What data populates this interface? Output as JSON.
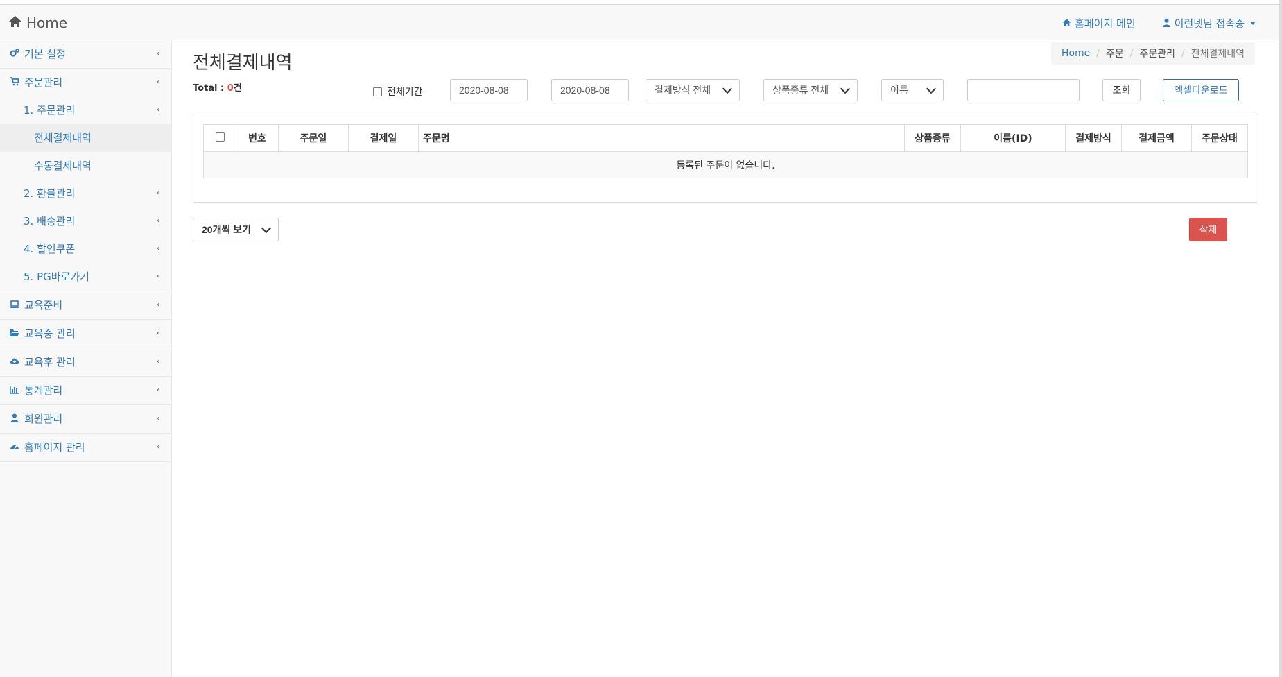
{
  "navbar": {
    "brand": "Home",
    "homepage_main": "홈페이지 메인",
    "user_status": "이런넷님 접속중"
  },
  "sidebar": {
    "items": [
      {
        "label": "기본 설정",
        "icon": "gears-icon"
      },
      {
        "label": "주문관리",
        "icon": "cart-icon"
      },
      {
        "label": "1. 주문관리"
      },
      {
        "label": "전체결제내역"
      },
      {
        "label": "수동결제내역"
      },
      {
        "label": "2. 환불관리"
      },
      {
        "label": "3. 배송관리"
      },
      {
        "label": "4. 할인쿠폰"
      },
      {
        "label": "5. PG바로가기"
      },
      {
        "label": "교육준비",
        "icon": "laptop-icon"
      },
      {
        "label": "교육중 관리",
        "icon": "folder-open-icon"
      },
      {
        "label": "교육후 관리",
        "icon": "cloud-upload-icon"
      },
      {
        "label": "통계관리",
        "icon": "bar-chart-icon"
      },
      {
        "label": "회원관리",
        "icon": "user-icon"
      },
      {
        "label": "홈페이지 관리",
        "icon": "dashboard-icon"
      }
    ]
  },
  "page": {
    "title": "전체결제내역",
    "breadcrumb": [
      "Home",
      "주문",
      "주문관리",
      "전체결제내역"
    ],
    "total_label": "Total : ",
    "total_count": "0",
    "total_unit": "건"
  },
  "filters": {
    "all_period_label": "전체기간",
    "date_from": "2020-08-08",
    "date_to": "2020-08-08",
    "payment_method": "결제방식 전체",
    "product_type": "상품종류 전체",
    "search_field": "이름",
    "search_value": "",
    "search_button": "조회",
    "excel_button": "엑셀다운로드"
  },
  "table": {
    "columns": [
      "번호",
      "주문일",
      "결제일",
      "주문명",
      "상품종류",
      "이름(ID)",
      "결제방식",
      "결제금액",
      "주문상태"
    ],
    "empty_message": "등록된 주문이 없습니다."
  },
  "footer": {
    "per_page": "20개씩 보기",
    "delete_button": "삭제"
  },
  "colors": {
    "link": "#337ab7",
    "danger": "#d9534f",
    "count": "#d9534f"
  }
}
